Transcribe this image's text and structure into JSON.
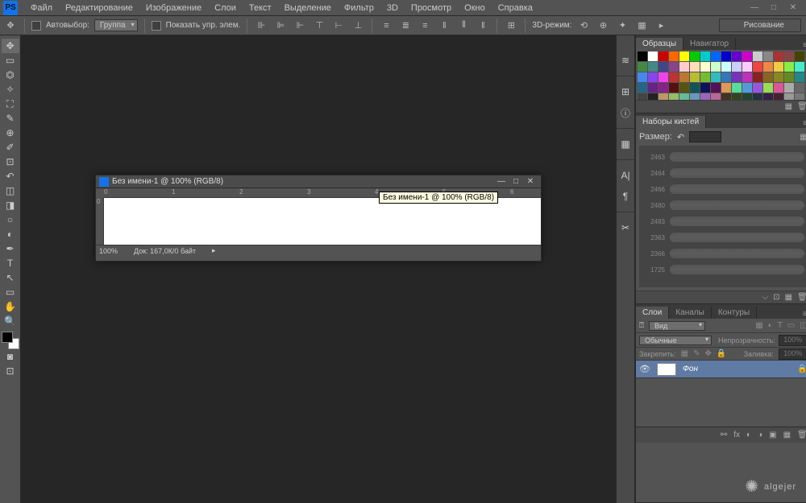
{
  "app": {
    "logo": "PS"
  },
  "menu": [
    "Файл",
    "Редактирование",
    "Изображение",
    "Слои",
    "Текст",
    "Выделение",
    "Фильтр",
    "3D",
    "Просмотр",
    "Окно",
    "Справка"
  ],
  "optbar": {
    "autoselect": "Автовыбор:",
    "group": "Группа",
    "showctrl": "Показать упр. элем.",
    "mode3d": "3D-режим:",
    "workspace": "Рисование"
  },
  "doc": {
    "title": "Без имени-1 @ 100% (RGB/8)",
    "tooltip": "Без имени-1 @ 100% (RGB/8)",
    "zoom": "100%",
    "status": "Док: 167,0К/0 байт",
    "ruler": {
      "r0": "0",
      "r1": "1",
      "r2": "2",
      "r3": "3",
      "r4": "4",
      "r5": "5",
      "r6": "6",
      "v0": "0"
    }
  },
  "panels": {
    "swatches_tab": "Образцы",
    "navigator_tab": "Навигатор",
    "brushes_tab": "Наборы кистей",
    "brush_size_label": "Размер:",
    "brush_ids": [
      "2463",
      "2464",
      "2466",
      "2480",
      "2483",
      "2363",
      "2366",
      "1725"
    ],
    "layers_tab": "Слои",
    "channels_tab": "Каналы",
    "paths_tab": "Контуры",
    "kind_label": "Вид",
    "blend_mode": "Обычные",
    "opacity_label": "Непрозрачность:",
    "opacity_val": "100%",
    "lock_label": "Закрепить:",
    "fill_label": "Заливка:",
    "fill_val": "100%",
    "layer_name": "Фон"
  },
  "swatch_colors": [
    "#000",
    "#fff",
    "#c00",
    "#f60",
    "#ff0",
    "#0c0",
    "#0cc",
    "#06f",
    "#00c",
    "#60c",
    "#c0c",
    "#ccc",
    "#888",
    "#a33",
    "#844",
    "#440",
    "#484",
    "#488",
    "#448",
    "#848",
    "#fcc",
    "#fdb",
    "#ffc",
    "#cfc",
    "#cff",
    "#ccf",
    "#fcf",
    "#e44",
    "#e84",
    "#ec4",
    "#8e4",
    "#4ec",
    "#48e",
    "#84e",
    "#e4e",
    "#b33",
    "#b73",
    "#bb3",
    "#7b3",
    "#3bb",
    "#37b",
    "#73b",
    "#b3b",
    "#822",
    "#862",
    "#882",
    "#682",
    "#288",
    "#268",
    "#628",
    "#828",
    "#511",
    "#551",
    "#155",
    "#115",
    "#515",
    "#d95",
    "#5d9",
    "#59d",
    "#95d",
    "#9d5",
    "#d59",
    "#aaa",
    "#666",
    "#444",
    "#222",
    "#b96",
    "#9b6",
    "#6b9",
    "#69b",
    "#96b",
    "#b69",
    "#432",
    "#342",
    "#243",
    "#234",
    "#324",
    "#423",
    "#999",
    "#777",
    "#555",
    "#333"
  ],
  "watermark": "algejer"
}
